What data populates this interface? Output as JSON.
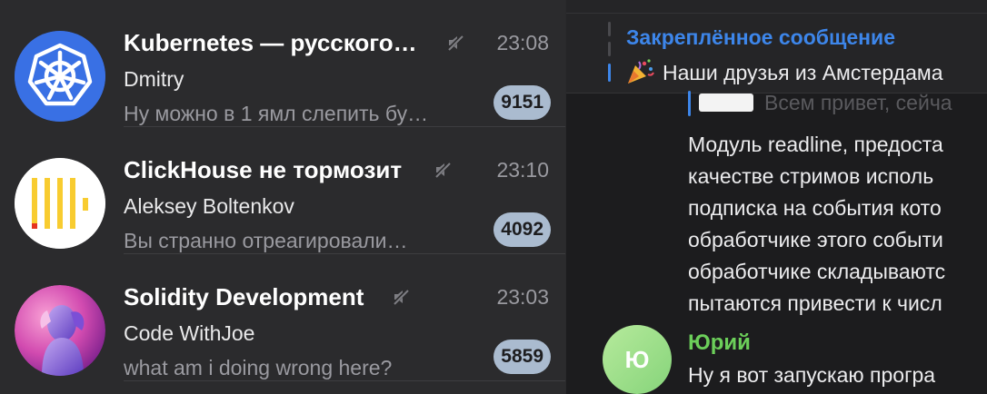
{
  "chats": [
    {
      "title": "Kubernetes — русского…",
      "time": "23:08",
      "sender": "Dmitry",
      "preview": "Ну можно в 1 ямл слепить бу…",
      "unread": "9151",
      "muted": true,
      "avatar": "kubernetes-logo"
    },
    {
      "title": "ClickHouse не тормозит",
      "time": "23:10",
      "sender": "Aleksey Boltenkov",
      "preview": "Вы странно отреагировали…",
      "unread": "4092",
      "muted": true,
      "avatar": "clickhouse-logo"
    },
    {
      "title": "Solidity Development",
      "time": "23:03",
      "sender": "Code WithJoe",
      "preview": "what am i doing wrong here?",
      "unread": "5859",
      "muted": true,
      "avatar": "solidity-art"
    }
  ],
  "conversation": {
    "pinned": {
      "label": "Закреплённое сообщение",
      "text": "Наши друзья из Амстердама"
    },
    "reply_preview": "Всем привет, сейча",
    "message_lines": [
      "Модуль readline, предоста",
      "качестве стримов исполь",
      "подписка на события кото",
      "обработчике этого событи",
      "обработчике складываютс",
      "пытаются привести к числ"
    ],
    "next_message": {
      "avatar_initial": "Ю",
      "author": "Юрий",
      "text": "Ну я вот запускаю програ"
    }
  },
  "colors": {
    "accent": "#3d86ea",
    "badge": "#aabbcf",
    "author_green": "#6ccf5a"
  }
}
